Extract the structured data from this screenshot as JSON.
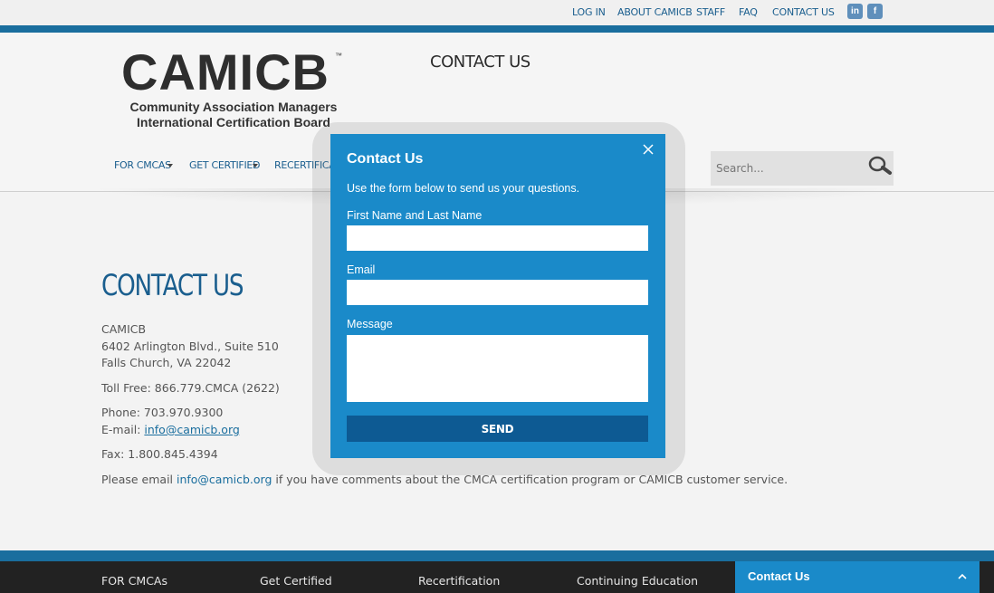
{
  "topnav": {
    "items": [
      "LOG IN",
      "ABOUT CAMICB",
      "STAFF",
      "FAQ",
      "CONTACT US"
    ],
    "linkedin_label": "in",
    "facebook_label": "f"
  },
  "header": {
    "logo_main": "CAMICB",
    "logo_tm": "™",
    "logo_line1": "Community Association Managers",
    "logo_line2": "International Certification Board",
    "title": "CONTACT US",
    "nav": [
      "FOR CMCAS",
      "GET CERTIFIED",
      "RECERTIFICATI"
    ],
    "search_placeholder": "Search..."
  },
  "content": {
    "title": "CONTACT US",
    "org": "CAMICB",
    "address1": "6402 Arlington Blvd., Suite 510",
    "address2": "Falls Church, VA 22042",
    "tollfree": "Toll Free: 866.779.CMCA (2622)",
    "phone": "Phone: 703.970.9300",
    "email_prefix": "E-mail: ",
    "email": "info@camicb.org",
    "fax": "Fax: 1.800.845.4394",
    "note_prefix": "Please email ",
    "note_email": "info@camicb.org",
    "note_suffix": " if you have comments about the CMCA certification program or CAMICB customer service."
  },
  "modal": {
    "title": "Contact Us",
    "description": "Use the form below to send us your questions.",
    "name_label": "First Name and Last Name",
    "name_value": "",
    "email_label": "Email",
    "email_value": "",
    "message_label": "Message",
    "message_value": "",
    "send_label": "SEND"
  },
  "footer": {
    "links": [
      "FOR CMCAs",
      "Get Certified",
      "Recertification",
      "Continuing Education"
    ],
    "contact_tab": "Contact Us"
  },
  "colors": {
    "brand_blue": "#1a6e9e",
    "modal_blue": "#1a8ac9",
    "button_blue": "#0d5a93"
  }
}
